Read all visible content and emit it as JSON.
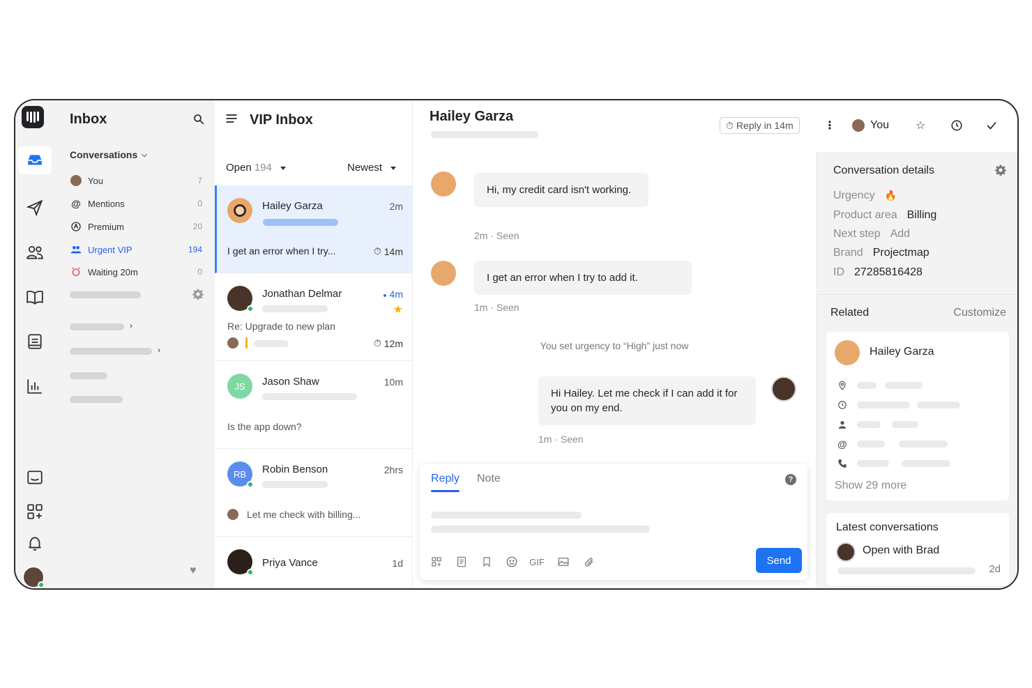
{
  "nav": {
    "title": "Inbox",
    "section": "Conversations",
    "items": [
      {
        "label": "You",
        "count": "7"
      },
      {
        "label": "Mentions",
        "count": "0"
      },
      {
        "label": "Premium",
        "count": "20"
      },
      {
        "label": "Urgent VIP",
        "count": "194"
      },
      {
        "label": "Waiting 20m",
        "count": "0"
      }
    ]
  },
  "list": {
    "title": "VIP Inbox",
    "filter_label": "Open",
    "filter_count": "194",
    "sort_label": "Newest",
    "conversations": [
      {
        "name": "Hailey Garza",
        "time": "2m",
        "preview": "I get an error when I try...",
        "timer": "14m"
      },
      {
        "name": "Jonathan Delmar",
        "time": "4m",
        "preview": "Re: Upgrade to new plan",
        "timer": "12m"
      },
      {
        "name": "Jason Shaw",
        "initials": "JS",
        "time": "10m",
        "preview": "Is the app down?"
      },
      {
        "name": "Robin Benson",
        "initials": "RB",
        "time": "2hrs",
        "preview": "Let me check with billing..."
      },
      {
        "name": "Priya Vance",
        "time": "1d"
      }
    ]
  },
  "chat": {
    "name": "Hailey Garza",
    "reply_in": "Reply in 14m",
    "assignee": "You",
    "messages": [
      {
        "text": "Hi, my credit card isn't working.",
        "meta": "2m · Seen"
      },
      {
        "text": "I get an error when I try to add it.",
        "meta": "1m · Seen"
      },
      {
        "text": "Hi Hailey. Let me check if I can add it for you on my end.",
        "meta": "1m · Seen"
      }
    ],
    "system_note": "You set urgency to “High” just now",
    "composer": {
      "tab_reply": "Reply",
      "tab_note": "Note",
      "gif": "GIF",
      "send": "Send",
      "help": "?"
    }
  },
  "details": {
    "title": "Conversation details",
    "fields": [
      {
        "key": "Urgency",
        "value": "🔥"
      },
      {
        "key": "Product area",
        "value": "Billing"
      },
      {
        "key": "Next step",
        "value": "Add"
      },
      {
        "key": "Brand",
        "value": "Projectmap"
      },
      {
        "key": "ID",
        "value": "27285816428"
      }
    ],
    "related_title": "Related",
    "customize": "Customize",
    "contact_name": "Hailey Garza",
    "show_more": "Show 29 more",
    "latest_title": "Latest conversations",
    "latest_item": "Open with Brad",
    "latest_time": "2d"
  },
  "colors": {
    "accent": "#2563eb",
    "send": "#1d73f2",
    "online": "#29b866",
    "star": "#f5b400",
    "js_avatar": "#7fd8a4",
    "rb_avatar": "#5b8def"
  }
}
